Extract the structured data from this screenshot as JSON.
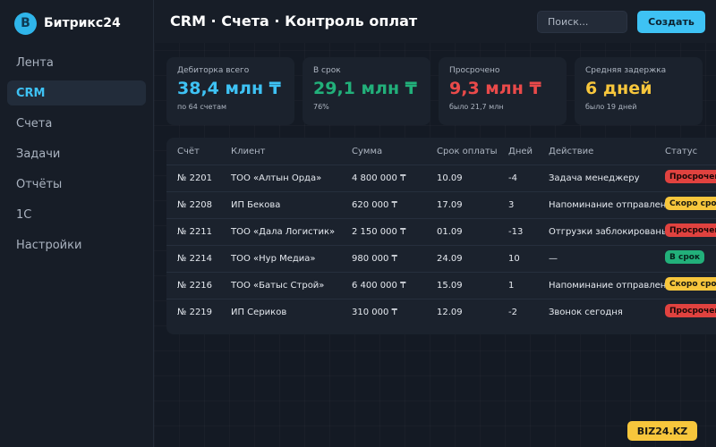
{
  "app": {
    "logo_letter": "B",
    "name": "Битрикс24"
  },
  "sidebar": {
    "items": [
      {
        "label": "Лента",
        "active": false
      },
      {
        "label": "CRM",
        "active": true
      },
      {
        "label": "Счета",
        "active": false
      },
      {
        "label": "Задачи",
        "active": false
      },
      {
        "label": "Отчёты",
        "active": false
      },
      {
        "label": "1С",
        "active": false
      },
      {
        "label": "Настройки",
        "active": false
      }
    ]
  },
  "header": {
    "title": "CRM · Счета · Контроль оплат",
    "search_placeholder": "Поиск...",
    "create_label": "Создать"
  },
  "kpis": [
    {
      "label": "Дебиторка всего",
      "value": "38,4 млн ₸",
      "sub": "по 64 счетам",
      "color": "#3ec2f4"
    },
    {
      "label": "В срок",
      "value": "29,1 млн ₸",
      "sub": "76%",
      "color": "#22b07a"
    },
    {
      "label": "Просрочено",
      "value": "9,3 млн ₸",
      "sub": "было 21,7 млн",
      "color": "#ea4a4a"
    },
    {
      "label": "Средняя задержка",
      "value": "6 дней",
      "sub": "было 19 дней",
      "color": "#f7c63c"
    }
  ],
  "table": {
    "headers": [
      "Счёт",
      "Клиент",
      "Сумма",
      "Срок оплаты",
      "Дней",
      "Действие",
      "Статус"
    ],
    "rows": [
      {
        "invoice": "№ 2201",
        "client": "ТОО «Алтын Орда»",
        "amount": "4 800 000 ₸",
        "due": "10.09",
        "days": "-4",
        "action": "Задача менеджеру",
        "status": "Просрочен",
        "status_kind": "overdue"
      },
      {
        "invoice": "№ 2208",
        "client": "ИП Бекова",
        "amount": "620 000 ₸",
        "due": "17.09",
        "days": "3",
        "action": "Напоминание отправлено",
        "status": "Скоро срок",
        "status_kind": "soon"
      },
      {
        "invoice": "№ 2211",
        "client": "ТОО «Дала Логистик»",
        "amount": "2 150 000 ₸",
        "due": "01.09",
        "days": "-13",
        "action": "Отгрузки заблокированы",
        "status": "Просрочен",
        "status_kind": "overdue"
      },
      {
        "invoice": "№ 2214",
        "client": "ТОО «Нур Медиа»",
        "amount": "980 000 ₸",
        "due": "24.09",
        "days": "10",
        "action": "—",
        "status": "В срок",
        "status_kind": "ontime"
      },
      {
        "invoice": "№ 2216",
        "client": "ТОО «Батыс Строй»",
        "amount": "6 400 000 ₸",
        "due": "15.09",
        "days": "1",
        "action": "Напоминание отправлено",
        "status": "Скоро срок",
        "status_kind": "soon"
      },
      {
        "invoice": "№ 2219",
        "client": "ИП Сериков",
        "amount": "310 000 ₸",
        "due": "12.09",
        "days": "-2",
        "action": "Звонок сегодня",
        "status": "Просрочен",
        "status_kind": "overdue"
      }
    ]
  },
  "status_colors": {
    "overdue": {
      "bg": "#e0423f",
      "fg": "#1a0808"
    },
    "soon": {
      "bg": "#f7c63c",
      "fg": "#1b1a10"
    },
    "ontime": {
      "bg": "#22b07a",
      "fg": "#07201a"
    }
  },
  "brand": {
    "label": "BIZ24.KZ"
  }
}
